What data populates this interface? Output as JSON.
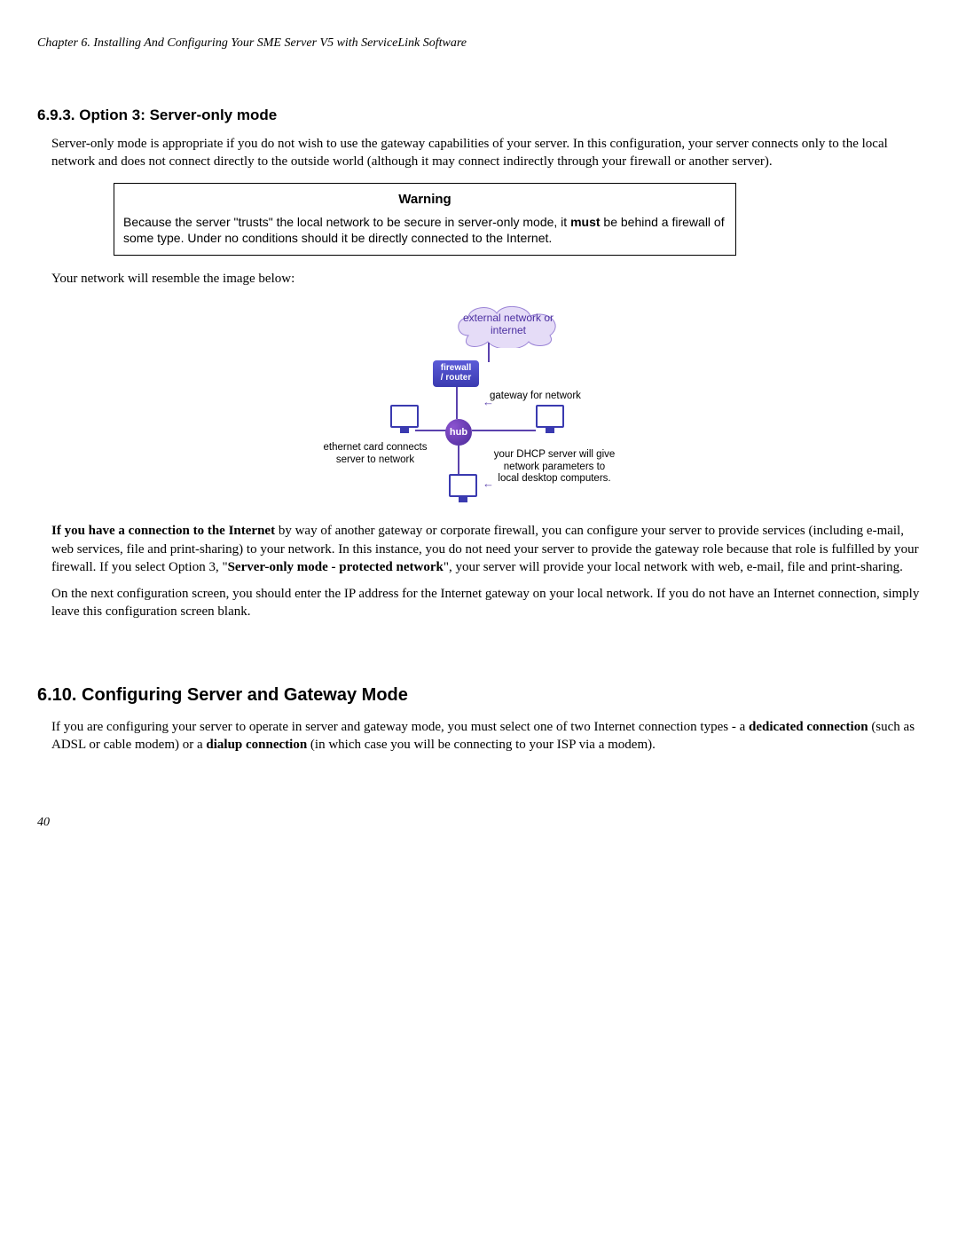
{
  "running_head": "Chapter 6. Installing And Configuring Your SME Server V5 with ServiceLink Software",
  "section_693": {
    "heading": "6.9.3. Option 3: Server-only mode",
    "para1": "Server-only mode is appropriate if you do not wish to use the gateway capabilities of your server. In this configuration, your server connects only to the local network and does not connect directly to the outside world (although it may connect indirectly through your firewall or another server).",
    "warning_title": "Warning",
    "warning_pre": "Because the server \"trusts\" the local network to be secure in server-only mode, it ",
    "warning_bold": "must",
    "warning_post": " be behind a firewall of some type. Under no conditions should it be directly connected to the Internet.",
    "after_warning": "Your network will resemble the image below:",
    "diagram": {
      "cloud": "external network or internet",
      "fw_top": "firewall",
      "fw_bot": "/ router",
      "hub": "hub",
      "gateway": "gateway for network",
      "eth_line1": "ethernet card connects",
      "eth_line2": "server to network",
      "dhcp_line1": "your DHCP server will give",
      "dhcp_line2": "network parameters to",
      "dhcp_line3": "local desktop computers."
    },
    "para2_lead": "If you have a connection to the Internet",
    "para2_mid": " by way of another gateway or corporate firewall, you can configure your server to provide services (including e-mail, web services, file and print-sharing) to your network. In this instance, you do not need your server to provide the gateway role because that role is fulfilled by your firewall. If you select Option 3, \"",
    "para2_bold2": "Server-only mode - protected network",
    "para2_tail": "\", your server will provide your local network with web, e-mail, file and print-sharing.",
    "para3": "On the next configuration screen, you should enter the IP address for the Internet gateway on your local network. If you do not have an Internet connection, simply leave this configuration screen blank."
  },
  "section_610": {
    "heading": "6.10. Configuring Server and Gateway Mode",
    "para1_a": "If you are configuring your server to operate in server and gateway mode, you must select one of two Internet connection types - a ",
    "para1_b1": "dedicated connection",
    "para1_c": "  (such as ADSL or cable modem) or a ",
    "para1_b2": "dialup connection",
    "para1_d": " (in which case you will be connecting to your ISP via a modem)."
  },
  "page_number": "40"
}
